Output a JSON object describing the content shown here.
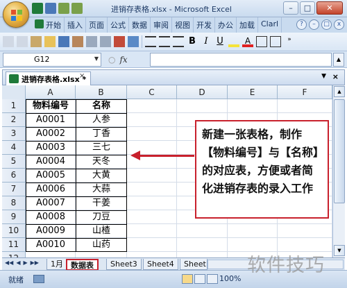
{
  "window": {
    "title": "进销存表格.xlsx - Microsoft Excel",
    "controls": [
      "–",
      "□",
      "✕"
    ]
  },
  "ribbon": {
    "tabs": [
      "开始",
      "插入",
      "页面",
      "公式",
      "数据",
      "审阅",
      "视图",
      "开发",
      "办公",
      "加载",
      "Clarl"
    ]
  },
  "formula_bar": {
    "name_box": "G12",
    "fx_label": "fx",
    "formula": ""
  },
  "workbook": {
    "tab_title": "进销存表格.xlsx *"
  },
  "sheet": {
    "columns": [
      "A",
      "B",
      "C",
      "D",
      "E",
      "F"
    ],
    "rows": [
      "1",
      "2",
      "3",
      "4",
      "5",
      "6",
      "7",
      "8",
      "9",
      "10",
      "11",
      "12"
    ],
    "header": [
      "物料编号",
      "名称"
    ],
    "data": [
      [
        "A0001",
        "人参"
      ],
      [
        "A0002",
        "丁香"
      ],
      [
        "A0003",
        "三七"
      ],
      [
        "A0004",
        "天冬"
      ],
      [
        "A0005",
        "大黄"
      ],
      [
        "A0006",
        "大蒜"
      ],
      [
        "A0007",
        "干姜"
      ],
      [
        "A0008",
        "刀豆"
      ],
      [
        "A0009",
        "山楂"
      ],
      [
        "A0010",
        "山药"
      ]
    ]
  },
  "callout": {
    "text": "新建一张表格，制作【物料编号】与【名称】的对应表，方便或者简化进销存表的录入工作",
    "color": "#c8202c"
  },
  "sheet_tabs": {
    "tabs": [
      "1月",
      "数据表",
      "Sheet3",
      "Sheet4",
      "Sheet"
    ],
    "active": "数据表"
  },
  "status_bar": {
    "status": "就绪",
    "zoom": "100%"
  },
  "watermark": "软件技巧"
}
